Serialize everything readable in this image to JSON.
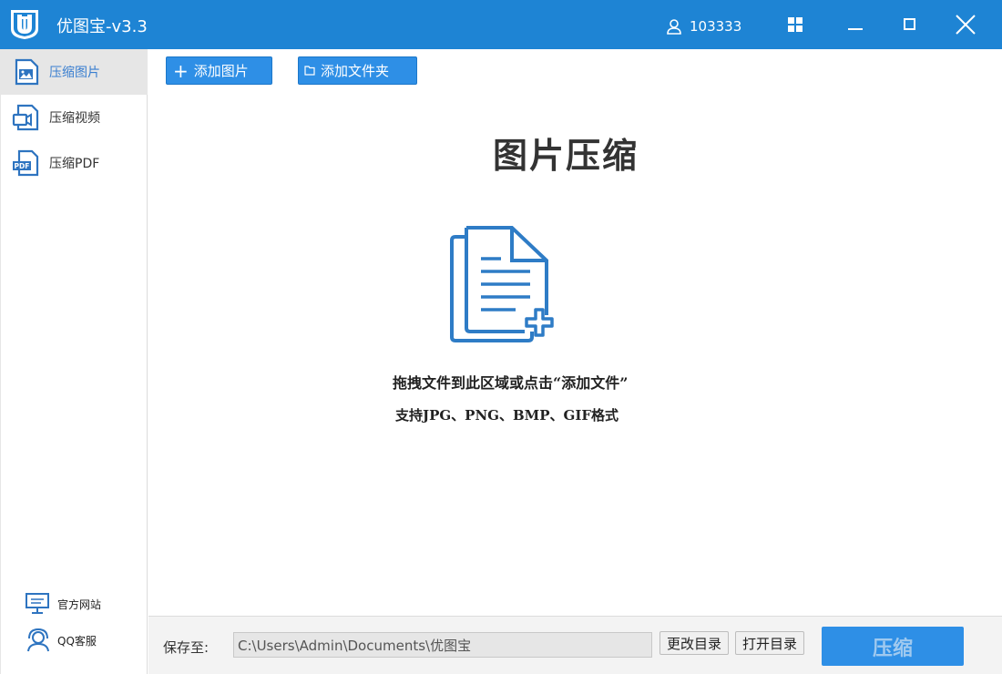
{
  "app": {
    "title": "优图宝-v3.3",
    "user_id": "103333",
    "accent_color": "#1e84d4"
  },
  "sidebar": {
    "items": [
      {
        "label": "压缩图片",
        "icon": "image-file-icon",
        "active": true
      },
      {
        "label": "压缩视频",
        "icon": "video-file-icon",
        "active": false
      },
      {
        "label": "压缩PDF",
        "icon": "pdf-file-icon",
        "active": false
      }
    ],
    "links": [
      {
        "label": "官方网站",
        "icon": "monitor-icon"
      },
      {
        "label": "QQ客服",
        "icon": "headset-icon"
      }
    ]
  },
  "toolbar": {
    "add_image_label": "添加图片",
    "add_folder_label": "添加文件夹"
  },
  "main": {
    "heading": "图片压缩",
    "drop_hint": "拖拽文件到此区域或点击“添加文件”",
    "formats_hint": "支持JPG、PNG、BMP、GIF格式"
  },
  "bottom": {
    "save_label": "保存至:",
    "save_path": "C:\\Users\\Admin\\Documents\\优图宝",
    "change_dir_label": "更改目录",
    "open_dir_label": "打开目录",
    "compress_label": "压缩"
  }
}
